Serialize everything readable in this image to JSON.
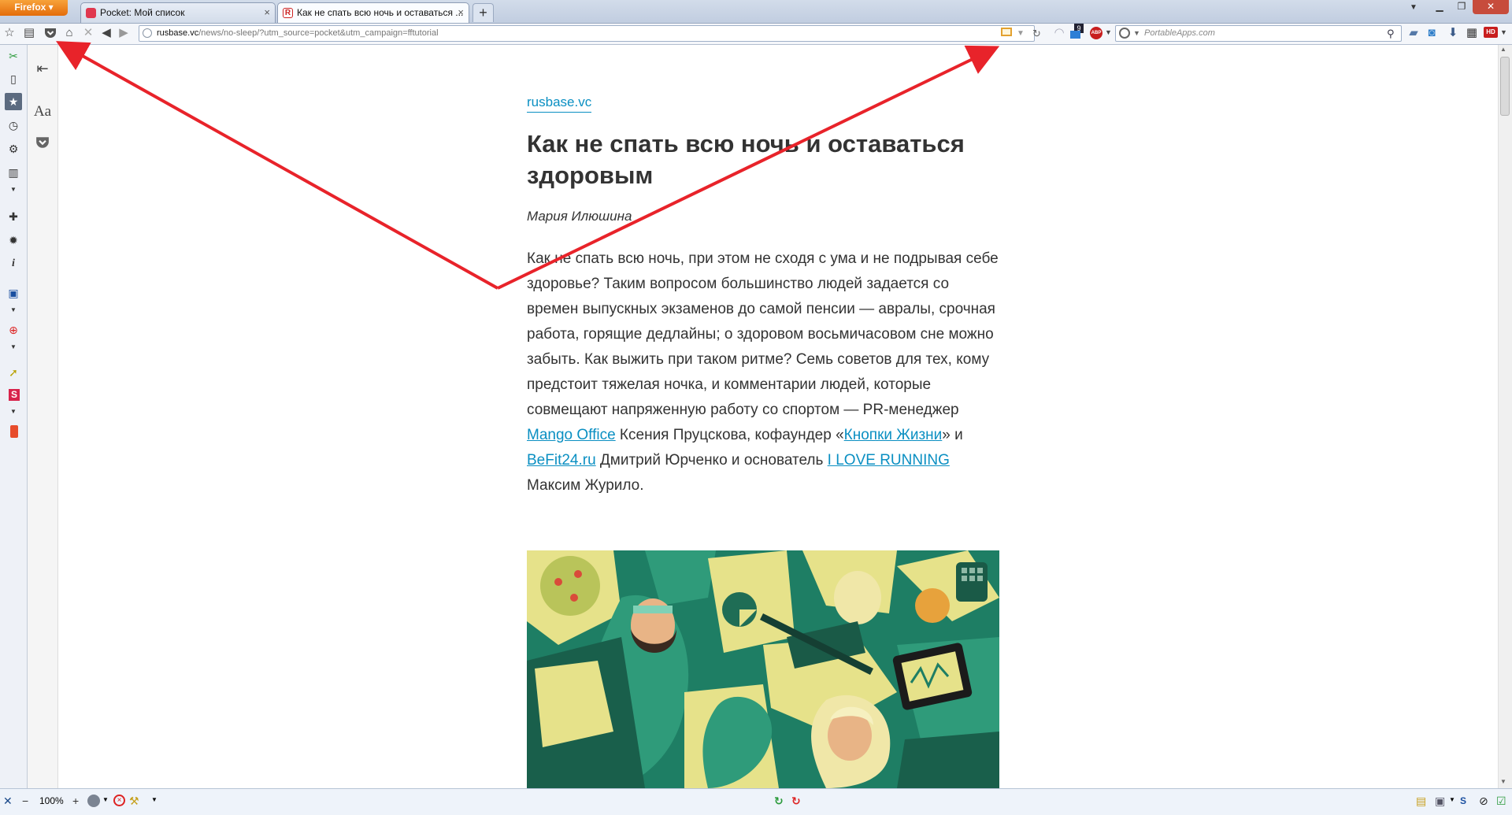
{
  "browser": {
    "menu_button": "Firefox",
    "tabs": [
      {
        "title": "Pocket: Мой список",
        "favicon_color": "#e0384f"
      },
      {
        "title": "Как не спать всю ночь и оставаться ...",
        "favicon_color": "#cc2222"
      }
    ],
    "new_tab": "+",
    "url_domain": "rusbase.vc",
    "url_path": "/news/no-sleep/?utm_source=pocket&utm_campaign=fftutorial",
    "search_placeholder": "PortableApps.com",
    "zoom": "100%",
    "notification_count": "9",
    "abp_label": "ABP"
  },
  "reader": {
    "font_label": "Aa"
  },
  "article": {
    "source": "rusbase.vc",
    "title": "Как не спать всю ночь и оставаться здоровым",
    "author": "Мария Илюшина",
    "body_start": "Как не спать всю ночь, при этом не сходя с ума и не подрывая себе здоровье? Таким вопросом большинство людей задается со времен выпускных экзаменов до самой пенсии — авралы, срочная работа, горящие дедлайны; о здоровом восьмичасовом сне можно забыть. Как выжить при таком ритме? Семь советов для тех, кому предстоит тяжелая ночка, и комментарии людей, которые совмещают напряженную работу со спортом — PR-менеджер ",
    "link1": "Mango Office",
    "body_mid1": " Ксения Пруцскова, кофаундер «",
    "link2": "Кнопки Жизни",
    "body_mid2": "» и ",
    "link3": "BeFit24.ru",
    "body_mid3": " Дмитрий Юрченко и основатель ",
    "link4": "I LOVE RUNNING",
    "body_end": " Максим Журило."
  },
  "colors": {
    "accent_link": "#0a8fc2",
    "arrow": "#e8232a",
    "illustration_green": "#1e7e64",
    "illustration_yellow": "#e6e28a"
  }
}
